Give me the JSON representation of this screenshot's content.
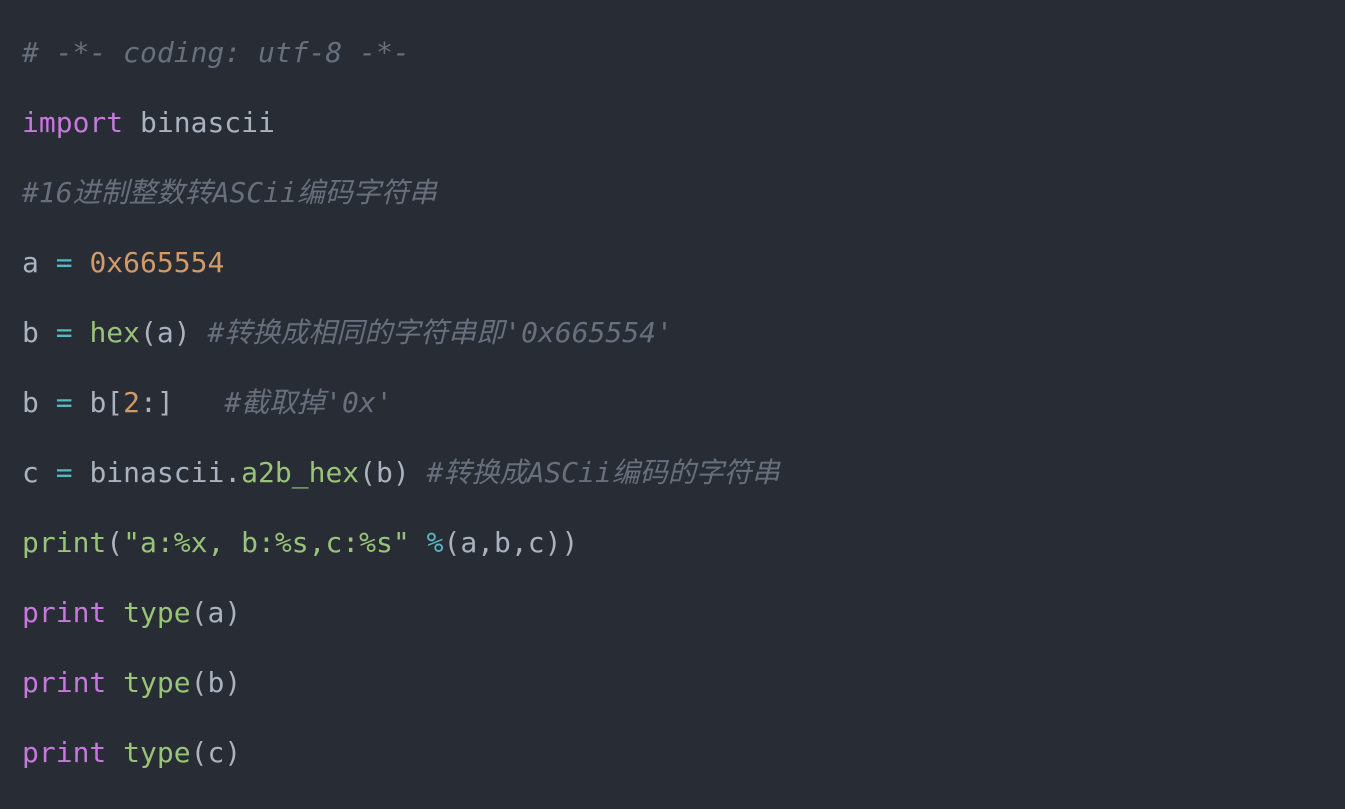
{
  "code": {
    "line1": {
      "comment": "# -*- coding: utf-8 -*-"
    },
    "line2": {
      "kw_import": "import",
      "module": "binascii"
    },
    "line3": {
      "comment": "#16进制整数转ASCii编码字符串"
    },
    "line4": {
      "var": "a",
      "op": "=",
      "num": "0x665554"
    },
    "line5": {
      "var": "b",
      "op": "=",
      "fn": "hex",
      "lp": "(",
      "arg": "a",
      "rp": ")",
      "comment": "#转换成相同的字符串即'0x665554'"
    },
    "line6": {
      "var": "b",
      "op": "=",
      "arr": "b",
      "lb": "[",
      "idx": "2",
      "colon": ":",
      "rb": "]",
      "comment": "#截取掉'0x'"
    },
    "line7": {
      "var": "c",
      "op": "=",
      "obj": "binascii",
      "dot": ".",
      "fn": "a2b_hex",
      "lp": "(",
      "arg": "b",
      "rp": ")",
      "comment": "#转换成ASCii编码的字符串"
    },
    "line8": {
      "fn": "print",
      "lp": "(",
      "str": "\"a:%x, b:%s,c:%s\"",
      "mod": "%",
      "lp2": "(",
      "a1": "a",
      "c1": ",",
      "a2": "b",
      "c2": ",",
      "a3": "c",
      "rp2": ")",
      "rp": ")"
    },
    "line9": {
      "kw": "print",
      "fn": "type",
      "lp": "(",
      "arg": "a",
      "rp": ")"
    },
    "line10": {
      "kw": "print",
      "fn": "type",
      "lp": "(",
      "arg": "b",
      "rp": ")"
    },
    "line11": {
      "kw": "print",
      "fn": "type",
      "lp": "(",
      "arg": "c",
      "rp": ")"
    }
  },
  "colors": {
    "background": "#282c34",
    "comment": "#676f7d",
    "keyword": "#c678dd",
    "builtin": "#61afef",
    "string": "#98c379",
    "number": "#d19a66",
    "operator": "#56b6c2",
    "default": "#abb2bf"
  }
}
